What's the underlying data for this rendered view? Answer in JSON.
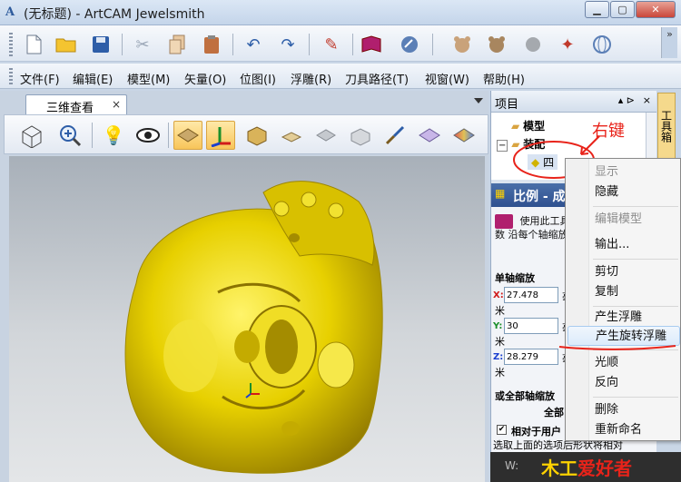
{
  "window": {
    "title": "(无标题) - ArtCAM Jewelsmith",
    "app_icon": "A"
  },
  "menu": {
    "items": [
      "文件(F)",
      "编辑(E)",
      "模型(M)",
      "矢量(O)",
      "位图(I)",
      "浮雕(R)",
      "刀具路径(T)",
      "视窗(W)",
      "帮助(H)"
    ]
  },
  "toolbar": {
    "more": "»"
  },
  "document": {
    "tab_label": "三维查看",
    "tab_close": "×"
  },
  "panel": {
    "title": "项目",
    "pin": "▴ ⊳",
    "close": "×",
    "tree": {
      "model": "模型",
      "assembly": "装配",
      "child": "四"
    },
    "section_title": "比例 - 成",
    "description": "使用此工具... 寸或百分比参数 沿每个轴缩放形 同百分比沿全部",
    "single_axis": "单轴缩放",
    "axes": [
      {
        "label": "X:",
        "value": "27.478",
        "unit": "米",
        "trunc": "毫"
      },
      {
        "label": "Y:",
        "value": "30",
        "unit": "米",
        "trunc": "毫"
      },
      {
        "label": "Z:",
        "value": "28.279",
        "unit": "米",
        "trunc": "毫"
      }
    ],
    "all_axis": "或全部轴缩放",
    "all_trunc": "全部",
    "relative_checkbox": "相对于用户",
    "footer": "选取上面的选项后形状将相对"
  },
  "side_tab": "工具箱",
  "context_menu": {
    "items": [
      {
        "label": "显示",
        "disabled": true
      },
      {
        "label": "隐藏",
        "disabled": false
      },
      {
        "label": "编辑模型",
        "disabled": true
      },
      {
        "label": "输出...",
        "disabled": false
      },
      {
        "label": "剪切",
        "disabled": false
      },
      {
        "label": "复制",
        "disabled": false
      },
      {
        "label": "产生浮雕",
        "disabled": false
      },
      {
        "label": "产生旋转浮雕",
        "disabled": false
      },
      {
        "label": "光顺",
        "disabled": false
      },
      {
        "label": "反向",
        "disabled": false
      },
      {
        "label": "删除",
        "disabled": false
      },
      {
        "label": "重新命名",
        "disabled": false
      }
    ]
  },
  "annotation": {
    "text": "右键",
    "color": "#e8231a"
  },
  "status": {
    "w_label": "W:",
    "logo_text_1": "木工",
    "logo_text_2": "爱好者"
  },
  "colors": {
    "model": "#e7d000",
    "viewport_top": "#a8b0b9",
    "accent": "#2f5190"
  }
}
